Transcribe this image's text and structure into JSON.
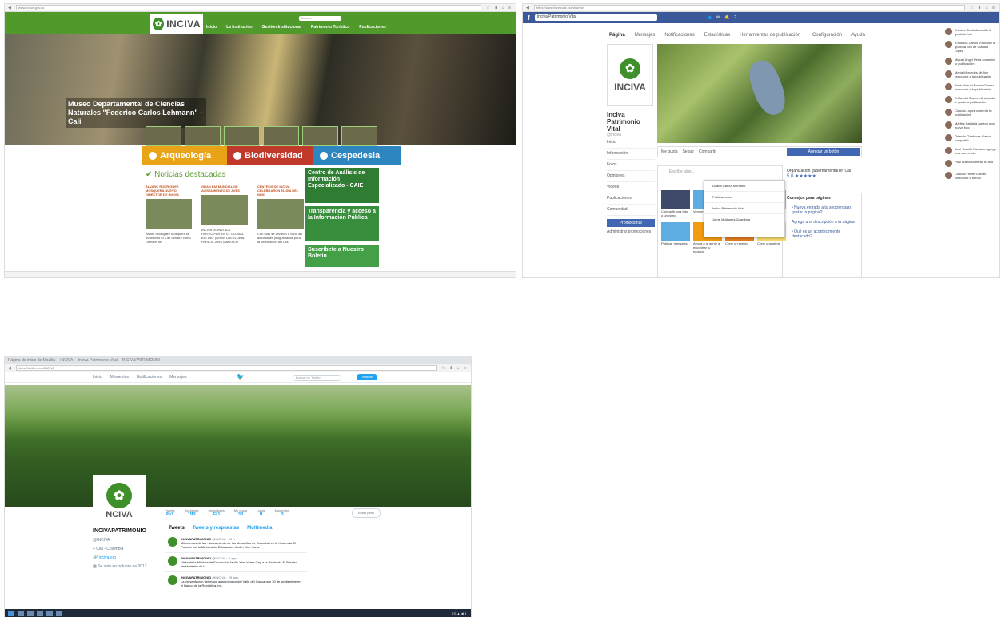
{
  "inciva": {
    "url": "www.inciva.gov.co",
    "logo_text": "INCIVA",
    "menu": [
      "Inicio",
      "La Institución",
      "Gestión Institucional",
      "Patrimonio Turístico",
      "Publicaciones"
    ],
    "hero_caption": "Museo Departamental de Ciencias Naturales \"Federico Carlos Lehmann\" - Cali",
    "categories": [
      {
        "label": "Arqueología",
        "color": "#e8a317"
      },
      {
        "label": "Biodiversidad",
        "color": "#c0392b"
      },
      {
        "label": "Cespedesia",
        "color": "#2e86c1"
      }
    ],
    "featured_title": "Noticias destacadas",
    "news": [
      {
        "title": "ÁLVARO RODRÍGUEZ MOSQUERA NUEVO DIRECTOR DE INCIVA",
        "body": "Álvaro Rodríguez Mosquera se posesionó el 2 de octubre como Director del"
      },
      {
        "title": "GRAN DÍA MUNDIAL DE AVISTAMIENTO DE AVES",
        "body": "INCIVA TE INVITA A PARTICIPAR EN EL GLOBAL BIG DAY (GRAN DÍA GLOBAL PARA EL AVISTAMIENTO"
      },
      {
        "title": "CENTROS DE INCIVA CELEBRARON EL DÍA DEL NIÑO",
        "body": "Con todo se llevaron a cabo las actividades programadas para la celebración del Día"
      }
    ],
    "side_boxes": [
      {
        "label": "Centro de Análisis de Información Especializado - CAIE",
        "color": "#2e7d32"
      },
      {
        "label": "Transparencia y acceso a la Información Pública",
        "color": "#388e3c"
      },
      {
        "label": "Suscríbete a Nuestro Boletín",
        "color": "#43a047"
      }
    ]
  },
  "facebook": {
    "url": "https://www.facebook.com/inciva/",
    "search_value": "Inciva Patrimonio Vital",
    "tabs": [
      "Página",
      "Mensajes",
      "Notificaciones",
      "Estadísticas",
      "Herramientas de publicación"
    ],
    "tabs_right": [
      "Configuración",
      "Ayuda"
    ],
    "page_name": "Inciva Patrimonio Vital",
    "handle": "@inciva",
    "left_menu": [
      "Inicio",
      "Información",
      "Fotos",
      "Opiniones",
      "Videos",
      "Publicaciones",
      "Comunidad"
    ],
    "promote_label": "Promocionar",
    "manage_promotions": "Administrar promociones",
    "actions": [
      "Me gusta",
      "Seguir",
      "Compartir"
    ],
    "send_message": "Agregar un botón",
    "org_title": "Organización gubernamental en Cali",
    "rating": "5,0 ★★★★★",
    "tips_title": "Consejos para páginas",
    "tips": [
      "¿Nueva entrada a tu sección para gustar la página?",
      "Agrega una descripción a tu página",
      "¿Qué es un acontecimiento destacado?"
    ],
    "tiles": [
      "Compartir una foto o un video",
      "Vender algo",
      "Iniciar transmisión",
      "Crear un evento",
      "Publicar mensajes",
      "Ayuda a la gente a encontrar tu negocio",
      "Crear un evento",
      "Crear una oferta"
    ],
    "dropdown": [
      "Liliana García Montaño",
      "Publicar como",
      "Inciva Patrimonio Vital",
      "Jorge Molinares Guardiola"
    ],
    "chat": [
      "A Jaime Tenia Jaramillo le gustó tu foto",
      "A Mónica Carlos Troncoso le gustó la foto de Claudia López",
      "Miguel Angel Peña comentó tu publicación",
      "María Mercedes Muñoz reaccionó a tu publicación",
      "José Manuel Porcio Gómez reaccionó a tu publicación",
      "A Ma. del Socorro Ahumada le gustó la publicación",
      "Claudia Lopez comentó tu publicación",
      "Martha Saldaña agregó una nueva foto",
      "Orlando Gárdenas García compartió",
      "José Camilo Ramírez agregó una nueva foto",
      "Pilar Arana comentó tu foto",
      "Claudia Ferrer Galván reaccionó a tu foto"
    ]
  },
  "twitter": {
    "url": "https://twitter.com/INCIVA",
    "nav": [
      "Inicio",
      "Momentos",
      "Notificaciones",
      "Mensajes"
    ],
    "search_placeholder": "Buscar en Twitter",
    "tweet_button": "Twittear",
    "avatar_text": "NCIVA",
    "stats": [
      {
        "label": "Tweets",
        "value": "951"
      },
      {
        "label": "Siguiendo",
        "value": "190"
      },
      {
        "label": "Seguidores",
        "value": "421"
      },
      {
        "label": "Me gusta",
        "value": "33"
      },
      {
        "label": "Listas",
        "value": "0"
      },
      {
        "label": "Momentos",
        "value": "0"
      }
    ],
    "follow_button": "Editar perfil",
    "profile_name": "INCIVAPATRIMONIO",
    "profile_handle": "@INCIVA",
    "profile_location": "Cali - Colombia",
    "profile_site": "inciva.org",
    "profile_joined": "Se unió en octubre de 2012",
    "tabs": [
      "Tweets",
      "Tweets y respuestas",
      "Multimedia"
    ],
    "tweets": [
      {
        "name": "INCIVAPATRIMONIO",
        "meta": "@INCIVA · 26 h",
        "text": "Mil cuentos de las - lanzamiento de las Maravillas de Colombia en la Hacienda El Paraíso por la Ministra de Educación. Jardín Yine Yume"
      },
      {
        "name": "INCIVAPATRIMONIO",
        "meta": "@INCIVA · 5 ago.",
        "text": "Visita de la Ministra de Educación Jardín Yine Yume Gey a la Hacienda El Paraíso - lanzamiento de la..."
      },
      {
        "name": "INCIVAPATRIMONIO",
        "meta": "@INCIVA · 29 ago.",
        "text": "La presentación del mapa arqueológico del Valle del Cauca que 30 de septiembre en el Banco de la República en..."
      }
    ]
  }
}
